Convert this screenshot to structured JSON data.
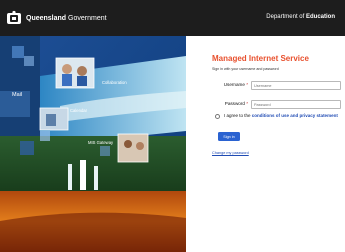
{
  "header": {
    "brand_name": "Queensland",
    "brand_suffix": "Government",
    "dept_prefix": "Department of",
    "dept_name": "Education"
  },
  "hero": {
    "tiles": {
      "mail": "Mail",
      "collaboration": "Collaboration",
      "calendar": "Calendar",
      "mis_gateway": "MIS Gateway"
    }
  },
  "login": {
    "title": "Managed Internet Service",
    "subtitle": "Sign in with your username and password",
    "username_label": "Username",
    "username_placeholder": "Username",
    "password_label": "Password",
    "password_placeholder": "Password",
    "required_mark": "*",
    "agree_prefix": "I agree to the",
    "agree_link": "conditions of use and privacy statement",
    "signin_label": "Sign in",
    "change_password_label": "Change my password"
  },
  "colors": {
    "header_bg": "#1d1d1d",
    "title": "#e8502d",
    "link": "#1f4bb4",
    "button": "#2a62d1"
  }
}
